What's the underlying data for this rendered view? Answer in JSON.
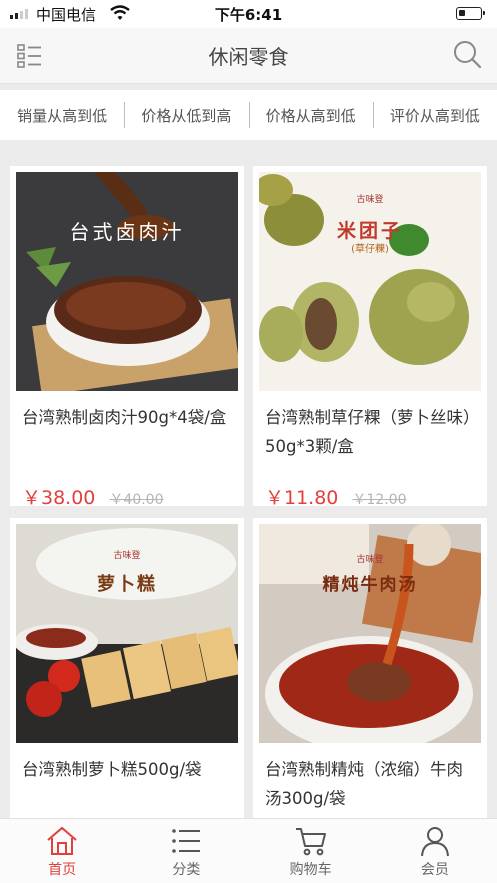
{
  "status": {
    "carrier": "中国电信",
    "time": "下午6:41"
  },
  "header": {
    "title": "休闲零食"
  },
  "sort_options": [
    "销量从高到低",
    "价格从低到高",
    "价格从高到低",
    "评价从高到低"
  ],
  "products": [
    {
      "name": "台湾熟制卤肉汁90g*4袋/盒",
      "price": "￥38.00",
      "original_price": "￥40.00",
      "image_banner": "台式卤肉汁",
      "image_brand": ""
    },
    {
      "name": "台湾熟制草仔粿（萝卜丝味）50g*3颗/盒",
      "price": "￥11.80",
      "original_price": "￥12.00",
      "image_banner": "米团子",
      "image_sub": "(草仔粿)",
      "image_brand": "古味登"
    },
    {
      "name": "台湾熟制萝卜糕500g/袋",
      "price": "",
      "original_price": "",
      "image_banner": "萝卜糕",
      "image_brand": "古味登"
    },
    {
      "name": "台湾熟制精炖（浓缩）牛肉汤300g/袋",
      "price": "",
      "original_price": "",
      "image_banner": "精炖牛肉汤",
      "image_brand": "古味登"
    }
  ],
  "tabbar": [
    {
      "label": "首页",
      "icon": "home-icon",
      "active": true
    },
    {
      "label": "分类",
      "icon": "list-icon",
      "active": false
    },
    {
      "label": "购物车",
      "icon": "cart-icon",
      "active": false
    },
    {
      "label": "会员",
      "icon": "user-icon",
      "active": false
    }
  ],
  "colors": {
    "accent": "#e2403d",
    "price": "#e2403d",
    "background": "#ebebeb"
  }
}
